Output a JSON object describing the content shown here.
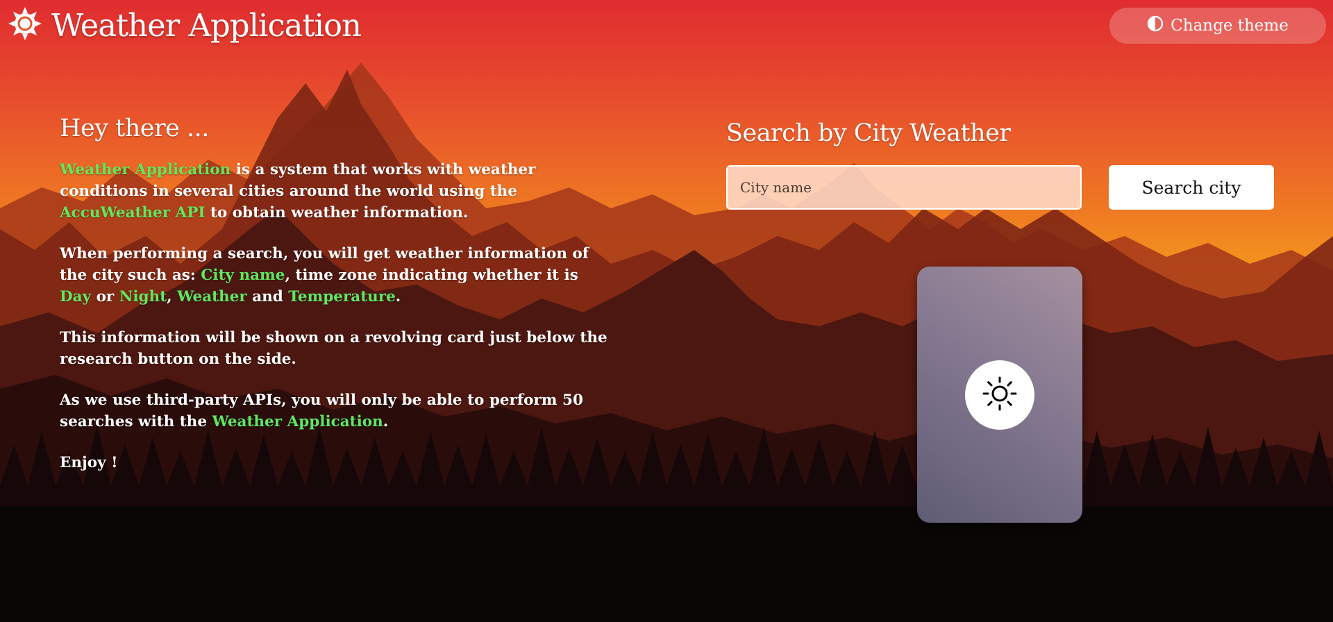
{
  "header": {
    "app_title": "Weather Application",
    "logo_icon": "sun-gear-icon",
    "theme_button_label": "Change theme",
    "theme_icon": "half-circle-contrast-icon"
  },
  "intro": {
    "heading": "Hey there ...",
    "p1": {
      "hl1": "Weather Application",
      "t1": " is a system that works with weather conditions in several cities around the world using the ",
      "hl2": "AccuWeather API",
      "t2": " to obtain weather information."
    },
    "p2": {
      "t1": "When performing a search, you will get weather information of the city such as: ",
      "hl1": "City name",
      "t2": ", time zone indicating whether it is ",
      "hl2": "Day",
      "t3": " or ",
      "hl3": "Night",
      "t4": ", ",
      "hl4": "Weather",
      "t5": " and ",
      "hl5": "Temperature",
      "t6": "."
    },
    "p3": "This information will be shown on a revolving card just below the research button on the side.",
    "p4": {
      "t1": "As we use third-party APIs, you will only be able to perform 50 searches with the ",
      "hl1": "Weather Application",
      "t2": "."
    },
    "p5": "Enjoy !"
  },
  "search": {
    "heading": "Search by City Weather",
    "input_placeholder": "City name",
    "input_value": "",
    "button_label": "Search city"
  },
  "card": {
    "icon": "sun-icon"
  },
  "colors": {
    "highlight": "#5fe85f",
    "sky_top": "#e23030",
    "sky_bottom": "#f7b318",
    "ground": "#0a0606"
  }
}
